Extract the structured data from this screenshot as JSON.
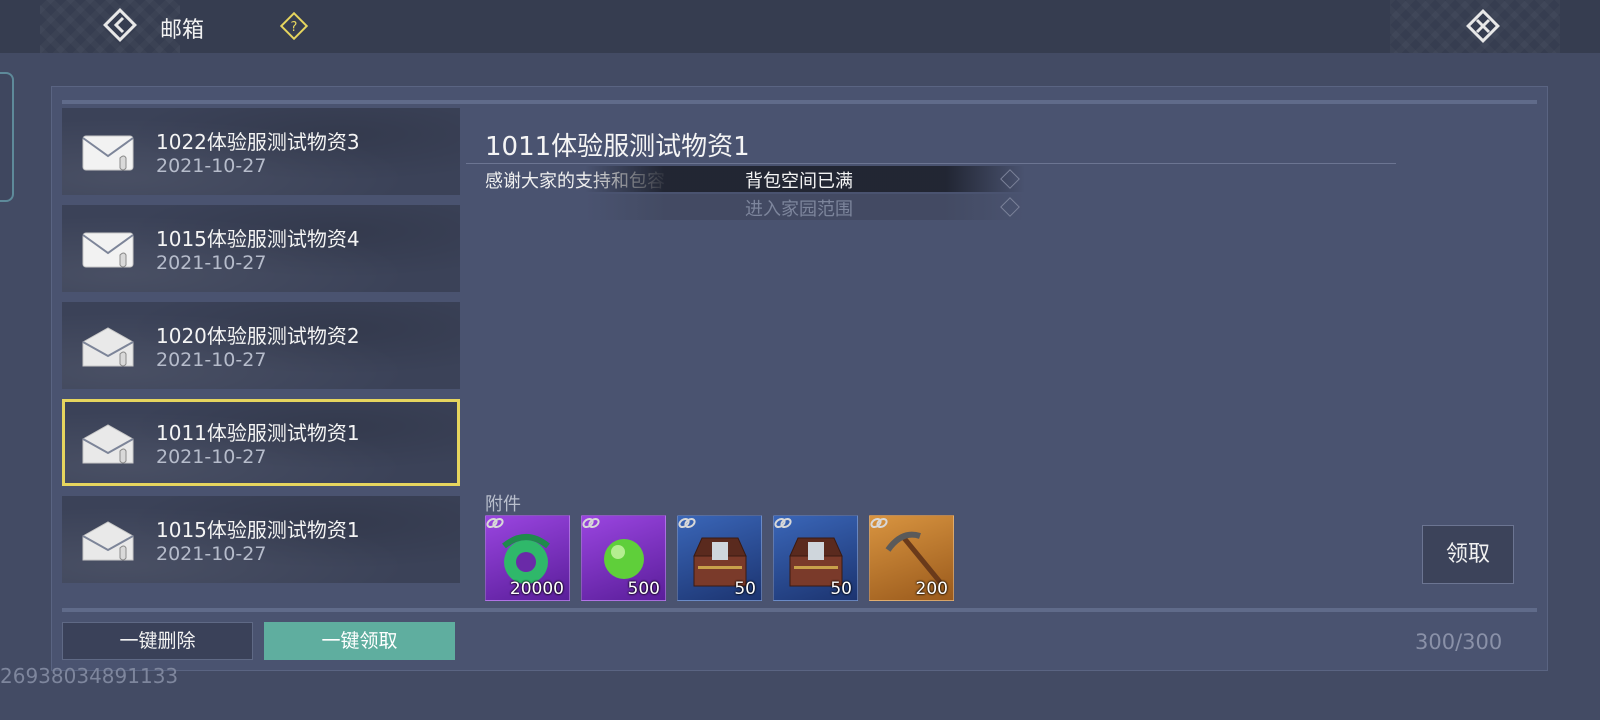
{
  "header": {
    "title": "邮箱",
    "back_icon": "back-diamond-icon",
    "help_icon": "question-diamond-icon",
    "close_icon": "close-diamond-icon"
  },
  "mail_list": [
    {
      "title": "1022体验服测试物资3",
      "date": "2021-10-27",
      "icon": "envelope-sealed-icon"
    },
    {
      "title": "1015体验服测试物资4",
      "date": "2021-10-27",
      "icon": "envelope-sealed-icon"
    },
    {
      "title": "1020体验服测试物资2",
      "date": "2021-10-27",
      "icon": "envelope-opened-icon"
    },
    {
      "title": "1011体验服测试物资1",
      "date": "2021-10-27",
      "icon": "envelope-opened-icon"
    },
    {
      "title": "1015体验服测试物资1",
      "date": "2021-10-27",
      "icon": "envelope-opened-icon"
    }
  ],
  "selected_index": 3,
  "detail": {
    "title": "1011体验服测试物资1",
    "body": "感谢大家的支持和包容",
    "attachments_label": "附件",
    "attachments": [
      {
        "count": "20000",
        "icon": "jade-ring-icon",
        "bg": "#7b2fc0"
      },
      {
        "count": "500",
        "icon": "green-orb-icon",
        "bg": "#7b2fc0"
      },
      {
        "count": "50",
        "icon": "treasure-chest-icon",
        "bg": "#2a4a8e"
      },
      {
        "count": "50",
        "icon": "treasure-chest-icon",
        "bg": "#2a4a8e"
      },
      {
        "count": "200",
        "icon": "pickaxe-icon",
        "bg": "#c07a2a"
      }
    ],
    "claim_label": "领取"
  },
  "toasts": [
    "背包空间已满",
    "进入家园范围"
  ],
  "footer": {
    "delete_all_label": "一键删除",
    "claim_all_label": "一键领取",
    "mail_count": "300/300"
  },
  "uid": "26938034891133",
  "colors": {
    "selected_border": "#e6d55e",
    "claim_all_bg": "#5fae9f",
    "panel_bg": "#4a5370"
  }
}
